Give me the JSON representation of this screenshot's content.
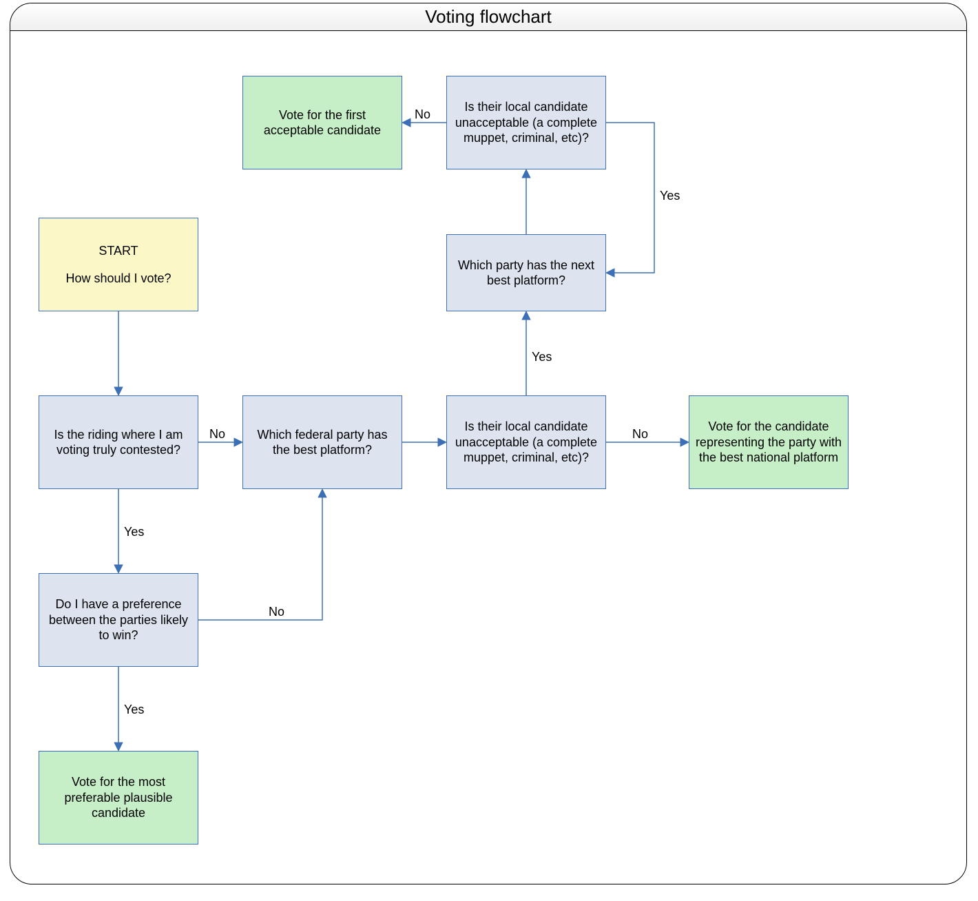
{
  "title": "Voting flowchart",
  "nodes": {
    "start": {
      "label1": "START",
      "label2": "How should I vote?"
    },
    "contested": "Is the riding where I am voting truly contested?",
    "preference": "Do I have a preference between the parties likely to win?",
    "vote_plausible": "Vote for the most preferable plausible candidate",
    "best_platform": "Which federal party has the best platform?",
    "unacceptable1": "Is their local candidate unacceptable (a complete muppet, criminal, etc)?",
    "vote_national": "Vote for the candidate representing the party with the best national platform",
    "next_best": "Which party has the next best platform?",
    "unacceptable2": "Is their local candidate unacceptable (a complete muppet, criminal, etc)?",
    "vote_first_acceptable": "Vote for the first acceptable candidate"
  },
  "edges": {
    "yes": "Yes",
    "no": "No"
  }
}
